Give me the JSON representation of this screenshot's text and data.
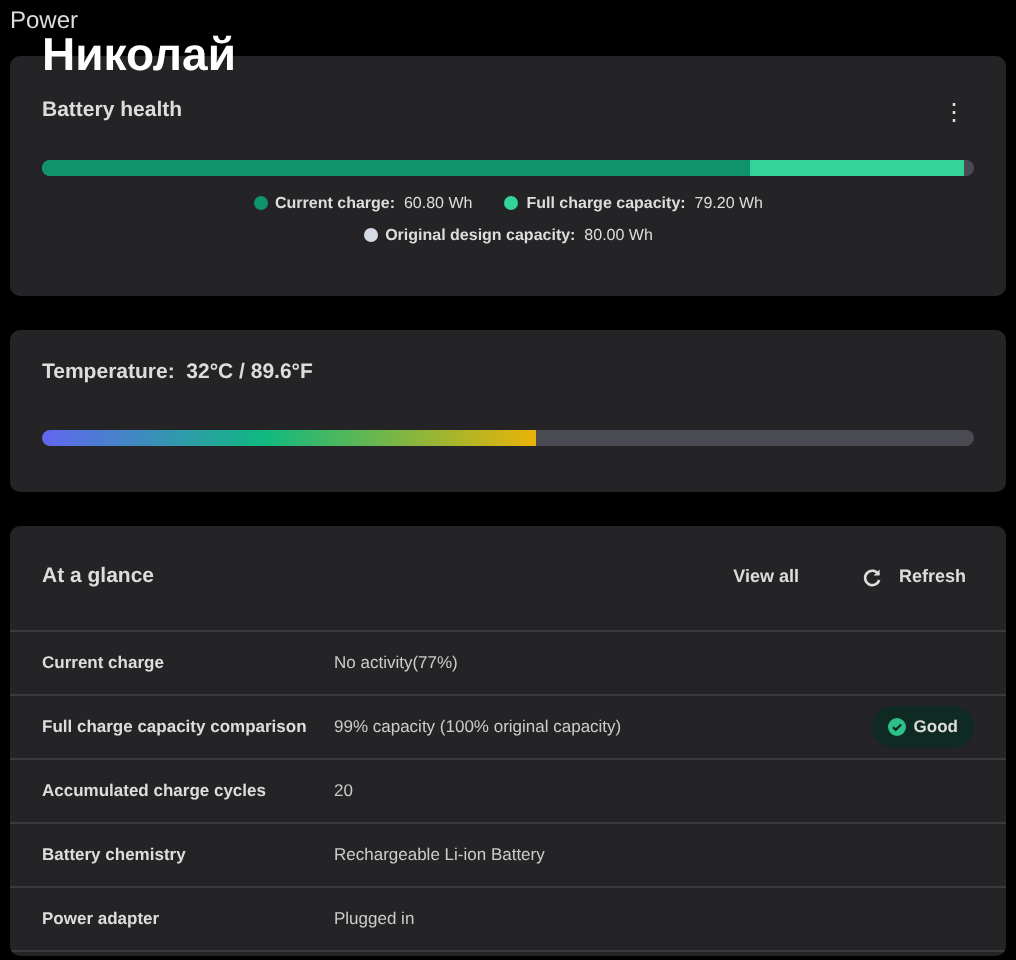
{
  "window": {
    "title": "Power"
  },
  "overlay_text": "Николай",
  "battery_health": {
    "title": "Battery health",
    "menu": "⋮",
    "legend": [
      {
        "label": "Current charge:",
        "value": "60.80 Wh",
        "color": "#10936a",
        "level": 0.76
      },
      {
        "label": "Full charge capacity:",
        "value": "79.20 Wh",
        "color": "#34d399",
        "level": 0.99
      },
      {
        "label": "Original design capacity:",
        "value": "80.00 Wh",
        "color": "#d4dae6"
      }
    ]
  },
  "temperature": {
    "label": "Temperature:",
    "value": "32°C / 89.6°F",
    "level": 0.53
  },
  "at_a_glance": {
    "title": "At a glance",
    "view_all": "View all",
    "refresh": "Refresh",
    "rows": [
      {
        "label": "Current charge",
        "value": "No activity(77%)"
      },
      {
        "label": "Full charge capacity comparison",
        "value": "99% capacity (100% original capacity)",
        "status": "Good"
      },
      {
        "label": "Accumulated charge cycles",
        "value": "20"
      },
      {
        "label": "Battery chemistry",
        "value": "Rechargeable Li-ion Battery"
      },
      {
        "label": "Power adapter",
        "value": "Plugged in"
      }
    ]
  }
}
